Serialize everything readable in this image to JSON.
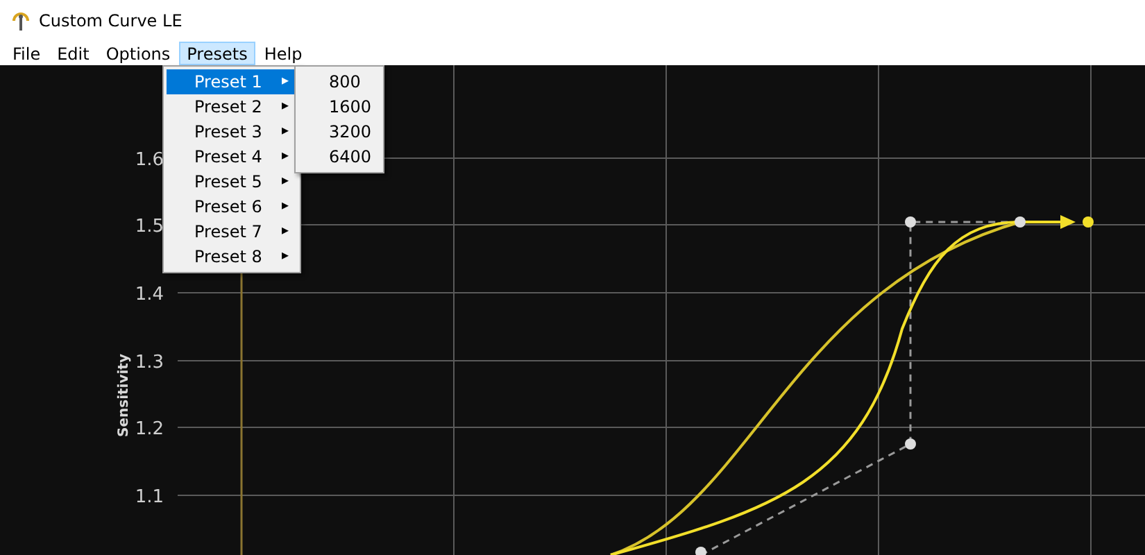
{
  "window": {
    "title": "Custom Curve LE"
  },
  "menu": [
    {
      "label": "File",
      "selected": false
    },
    {
      "label": "Edit",
      "selected": false
    },
    {
      "label": "Options",
      "selected": false
    },
    {
      "label": "Presets",
      "selected": true
    },
    {
      "label": "Help",
      "selected": false
    }
  ],
  "presets_menu": [
    {
      "label": "Preset 1",
      "selected": true
    },
    {
      "label": "Preset 2",
      "selected": false
    },
    {
      "label": "Preset 3",
      "selected": false
    },
    {
      "label": "Preset 4",
      "selected": false
    },
    {
      "label": "Preset 5",
      "selected": false
    },
    {
      "label": "Preset 6",
      "selected": false
    },
    {
      "label": "Preset 7",
      "selected": false
    },
    {
      "label": "Preset 8",
      "selected": false
    }
  ],
  "submenu_arrow": "▸",
  "submenu": [
    "800",
    "1600",
    "3200",
    "6400"
  ],
  "graph": {
    "ylabel": "Sensitivity",
    "yticks": [
      "1.6",
      "1.5",
      "1.4",
      "1.3",
      "1.2",
      "1.1"
    ]
  }
}
